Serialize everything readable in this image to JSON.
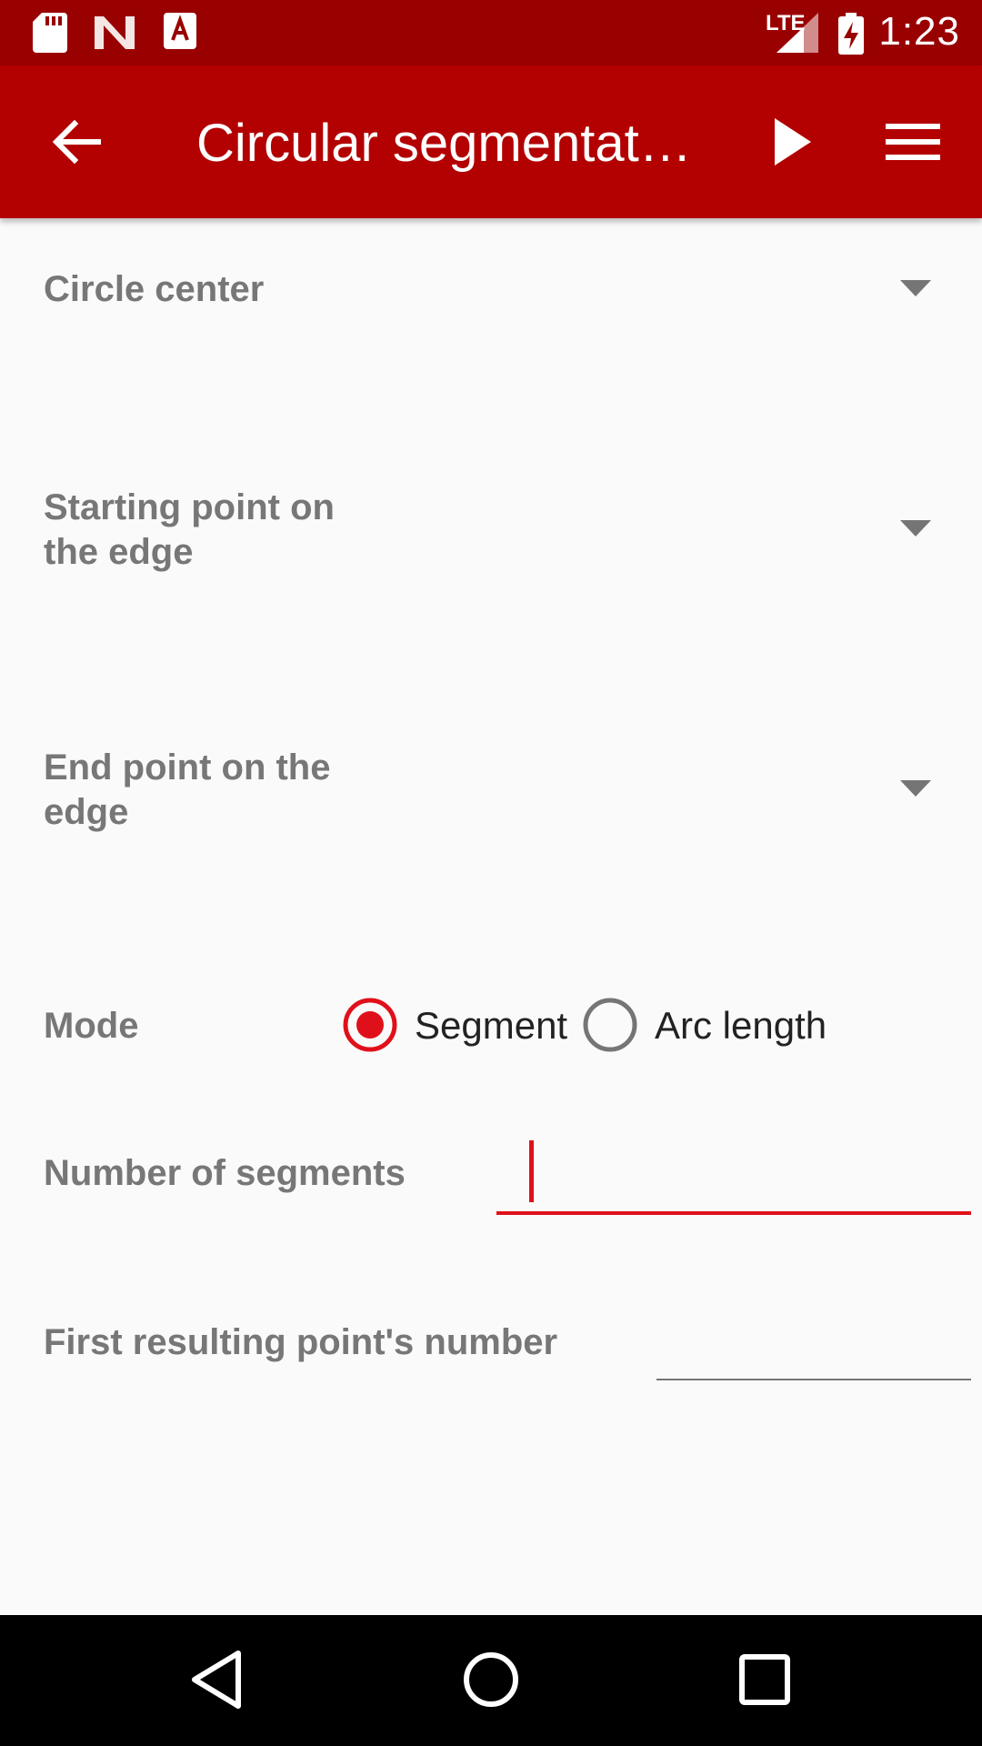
{
  "status_bar": {
    "time": "1:23",
    "network": "LTE"
  },
  "app_bar": {
    "title": "Circular segmentat…",
    "back_icon": "arrow-left-icon",
    "run_icon": "play-icon",
    "menu_icon": "menu-icon"
  },
  "form": {
    "circle_center": {
      "label": "Circle center"
    },
    "start_point": {
      "label_line1": "Starting point on",
      "label_line2": "the edge"
    },
    "end_point": {
      "label_line1": "End point on the",
      "label_line2": "edge"
    },
    "mode": {
      "label": "Mode",
      "options": [
        {
          "label": "Segment",
          "selected": true
        },
        {
          "label": "Arc length",
          "selected": false
        }
      ]
    },
    "num_segments": {
      "label": "Number of segments",
      "value": ""
    },
    "first_point_number": {
      "label": "First resulting point's number",
      "value": ""
    }
  },
  "colors": {
    "status_bar": "#990000",
    "app_bar": "#b30000",
    "accent": "#e0101a",
    "label": "#777777"
  }
}
